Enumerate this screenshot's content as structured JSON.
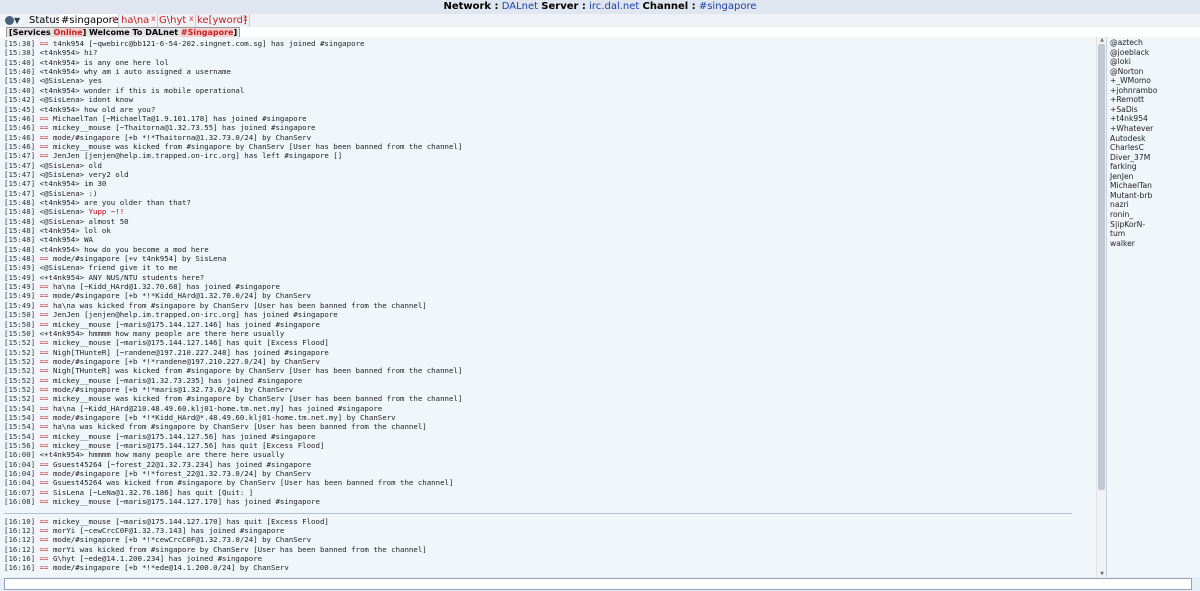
{
  "header": {
    "network_label": "Network :",
    "network": "DALnet",
    "server_label": "Server :",
    "server": "irc.dal.net",
    "channel_label": "Channel :",
    "channel": "#singapore"
  },
  "tabs": [
    {
      "label": "Status",
      "close": ""
    },
    {
      "label": "#singapore",
      "close": "x"
    },
    {
      "label": "ha\\na",
      "close": "x"
    },
    {
      "label": "G\\hyt",
      "close": "x"
    },
    {
      "label": "ke[yword]",
      "close": "x"
    }
  ],
  "topic": {
    "p1": "[Services ",
    "p2": "Online",
    "p3": "] Welcome To DALnet ",
    "p4": "#Singapore",
    "p5": "]"
  },
  "log": [
    {
      "ts": "[15:38]",
      "msg": "== t4nk954 [~qwebirc@bb121-6-54-202.singnet.com.sg] has joined #singapore",
      "ev": true
    },
    {
      "ts": "[15:38]",
      "msg": "<t4nk954> hi?",
      "ev": false
    },
    {
      "ts": "[15:40]",
      "msg": "<t4nk954> is any one here lol",
      "ev": false
    },
    {
      "ts": "[15:40]",
      "msg": "<t4nk954> why am i auto assigned a username",
      "ev": false
    },
    {
      "ts": "[15:40]",
      "msg": "<@SisLena> yes",
      "ev": false
    },
    {
      "ts": "[15:40]",
      "msg": "<t4nk954> wonder if this is mobile operational",
      "ev": false
    },
    {
      "ts": "[15:42]",
      "msg": "<@SisLena> idont know",
      "ev": false
    },
    {
      "ts": "[15:45]",
      "msg": "<t4nk954> how old are you?",
      "ev": false
    },
    {
      "ts": "[15:46]",
      "msg": "== MichaelTan [~MichaelTa@1.9.101.178] has joined #singapore",
      "ev": true
    },
    {
      "ts": "[15:46]",
      "msg": "== mickey__mouse [~Thaitorna@1.32.73.55] has joined #singapore",
      "ev": true
    },
    {
      "ts": "[15:46]",
      "msg": "== mode/#singapore [+b *!*Thaitorna@1.32.73.0/24] by ChanServ",
      "ev": true
    },
    {
      "ts": "[15:46]",
      "msg": "== mickey__mouse was kicked from #singapore by ChanServ [User has been banned from the channel]",
      "ev": true
    },
    {
      "ts": "[15:47]",
      "msg": "== JenJen [jenjen@help.im.trapped.on-irc.org] has left #singapore []",
      "ev": true
    },
    {
      "ts": "[15:47]",
      "msg": "<@SisLena> old",
      "ev": false
    },
    {
      "ts": "[15:47]",
      "msg": "<@SisLena> very2 old",
      "ev": false
    },
    {
      "ts": "[15:47]",
      "msg": "<t4nk954> im 30",
      "ev": false
    },
    {
      "ts": "[15:47]",
      "msg": "<@SisLena> :)",
      "ev": false
    },
    {
      "ts": "[15:48]",
      "msg": "<t4nk954> are you older than that?",
      "ev": false
    },
    {
      "ts": "[15:48]",
      "msg": "<@SisLena> Yupp ~!!",
      "ev": false,
      "hl": "Yupp ~!!"
    },
    {
      "ts": "[15:48]",
      "msg": "<@SisLena> almost 50",
      "ev": false
    },
    {
      "ts": "[15:48]",
      "msg": "<t4nk954> lol ok",
      "ev": false
    },
    {
      "ts": "[15:48]",
      "msg": "<t4nk954> WA",
      "ev": false
    },
    {
      "ts": "[15:48]",
      "msg": "<t4nk954> how do you become a mod here",
      "ev": false
    },
    {
      "ts": "[15:48]",
      "msg": "== mode/#singapore [+v t4nk954] by SisLena",
      "ev": true
    },
    {
      "ts": "[15:49]",
      "msg": "<@SisLena> friend give it to me",
      "ev": false
    },
    {
      "ts": "[15:49]",
      "msg": "<+t4nk954> ANY NUS/NTU students here?",
      "ev": false
    },
    {
      "ts": "[15:49]",
      "msg": "== ha\\na [~Kidd_HArd@1.32.70.68] has joined #singapore",
      "ev": true
    },
    {
      "ts": "[15:49]",
      "msg": "== mode/#singapore [+b *!*Kidd_HArd@1.32.70.0/24] by ChanServ",
      "ev": true
    },
    {
      "ts": "[15:49]",
      "msg": "== ha\\na was kicked from #singapore by ChanServ [User has been banned from the channel]",
      "ev": true
    },
    {
      "ts": "[15:50]",
      "msg": "== JenJen [jenjen@help.im.trapped.on-irc.org] has joined #singapore",
      "ev": true
    },
    {
      "ts": "[15:50]",
      "msg": "== mickey__mouse [~maris@175.144.127.146] has joined #singapore",
      "ev": true
    },
    {
      "ts": "[15:50]",
      "msg": "<+t4nk954> hmmmm how many people are there here usually",
      "ev": false
    },
    {
      "ts": "[15:52]",
      "msg": "== mickey__mouse [~maris@175.144.127.146] has quit [Excess Flood]",
      "ev": true
    },
    {
      "ts": "[15:52]",
      "msg": "== Nigh[THunteR] [~randene@197.210.227.248] has joined #singapore",
      "ev": true
    },
    {
      "ts": "[15:52]",
      "msg": "== mode/#singapore [+b *!*randene@197.210.227.0/24] by ChanServ",
      "ev": true
    },
    {
      "ts": "[15:52]",
      "msg": "== Nigh[THunteR] was kicked from #singapore by ChanServ [User has been banned from the channel]",
      "ev": true
    },
    {
      "ts": "[15:52]",
      "msg": "== mickey__mouse [~maris@1.32.73.235] has joined #singapore",
      "ev": true
    },
    {
      "ts": "[15:52]",
      "msg": "== mode/#singapore [+b *!*maris@1.32.73.0/24] by ChanServ",
      "ev": true
    },
    {
      "ts": "[15:52]",
      "msg": "== mickey__mouse was kicked from #singapore by ChanServ [User has been banned from the channel]",
      "ev": true
    },
    {
      "ts": "[15:54]",
      "msg": "== ha\\na [~Kidd_HArd@210.48.49.60.klj01-home.tm.net.my] has joined #singapore",
      "ev": true
    },
    {
      "ts": "[15:54]",
      "msg": "== mode/#singapore [+b *!*Kidd_HArd@*.48.49.60.klj01-home.tm.net.my] by ChanServ",
      "ev": true
    },
    {
      "ts": "[15:54]",
      "msg": "== ha\\na was kicked from #singapore by ChanServ [User has been banned from the channel]",
      "ev": true
    },
    {
      "ts": "[15:54]",
      "msg": "== mickey__mouse [~maris@175.144.127.56] has joined #singapore",
      "ev": true
    },
    {
      "ts": "[15:56]",
      "msg": "== mickey__mouse [~maris@175.144.127.56] has quit [Excess Flood]",
      "ev": true
    },
    {
      "ts": "[16:00]",
      "msg": "<+t4nk954> hmmmm how many people are there here usually",
      "ev": false
    },
    {
      "ts": "[16:04]",
      "msg": "== Gsuest45264 [~forest_22@1.32.73.234] has joined #singapore",
      "ev": true
    },
    {
      "ts": "[16:04]",
      "msg": "== mode/#singapore [+b *!*forest_22@1.32.73.0/24] by ChanServ",
      "ev": true
    },
    {
      "ts": "[16:04]",
      "msg": "== Gsuest45264 was kicked from #singapore by ChanServ [User has been banned from the channel]",
      "ev": true
    },
    {
      "ts": "[16:07]",
      "msg": "== SisLena [~LeNa@1.32.76.186] has quit [Quit: ]",
      "ev": true
    },
    {
      "ts": "[16:08]",
      "msg": "== mickey__mouse [~maris@175.144.127.170] has joined #singapore",
      "ev": true
    },
    {
      "ts": "[16:10]",
      "msg": "== mickey__mouse [~maris@175.144.127.170] has quit [Excess Flood]",
      "ev": true
    },
    {
      "ts": "[16:12]",
      "msg": "== morYi [~cewCrcC0F@1.32.73.143] has joined #singapore",
      "ev": true
    },
    {
      "ts": "[16:12]",
      "msg": "== mode/#singapore [+b *!*cewCrcC0F@1.32.73.0/24] by ChanServ",
      "ev": true
    },
    {
      "ts": "[16:12]",
      "msg": "== morYi was kicked from #singapore by ChanServ [User has been banned from the channel]",
      "ev": true
    },
    {
      "ts": "[16:16]",
      "msg": "== G\\hyt [~ede@14.1.200.234] has joined #singapore",
      "ev": true
    },
    {
      "ts": "[16:16]",
      "msg": "== mode/#singapore [+b *!*ede@14.1.200.0/24] by ChanServ",
      "ev": true
    }
  ],
  "nicks": [
    "@aztech",
    "@joeblack",
    "@loki",
    "@Norton",
    "+_WMomo",
    "+johnrambo",
    "+Remott",
    "+SaDis",
    "+t4nk954",
    "+Whatever",
    "Autodesk",
    "CharlesC",
    "Diver_37M",
    "farking",
    "JenJen",
    "MichaelTan",
    "Mutant-brb",
    "nazri",
    "ronin_",
    "S|ipKorN-",
    "tum",
    "walker"
  ],
  "icons": {
    "menu": "gear-icon",
    "close": "close-icon"
  },
  "colors": {
    "event": "#c42121",
    "link": "#1c3fa8",
    "log_bg": "#f1f6fb"
  }
}
